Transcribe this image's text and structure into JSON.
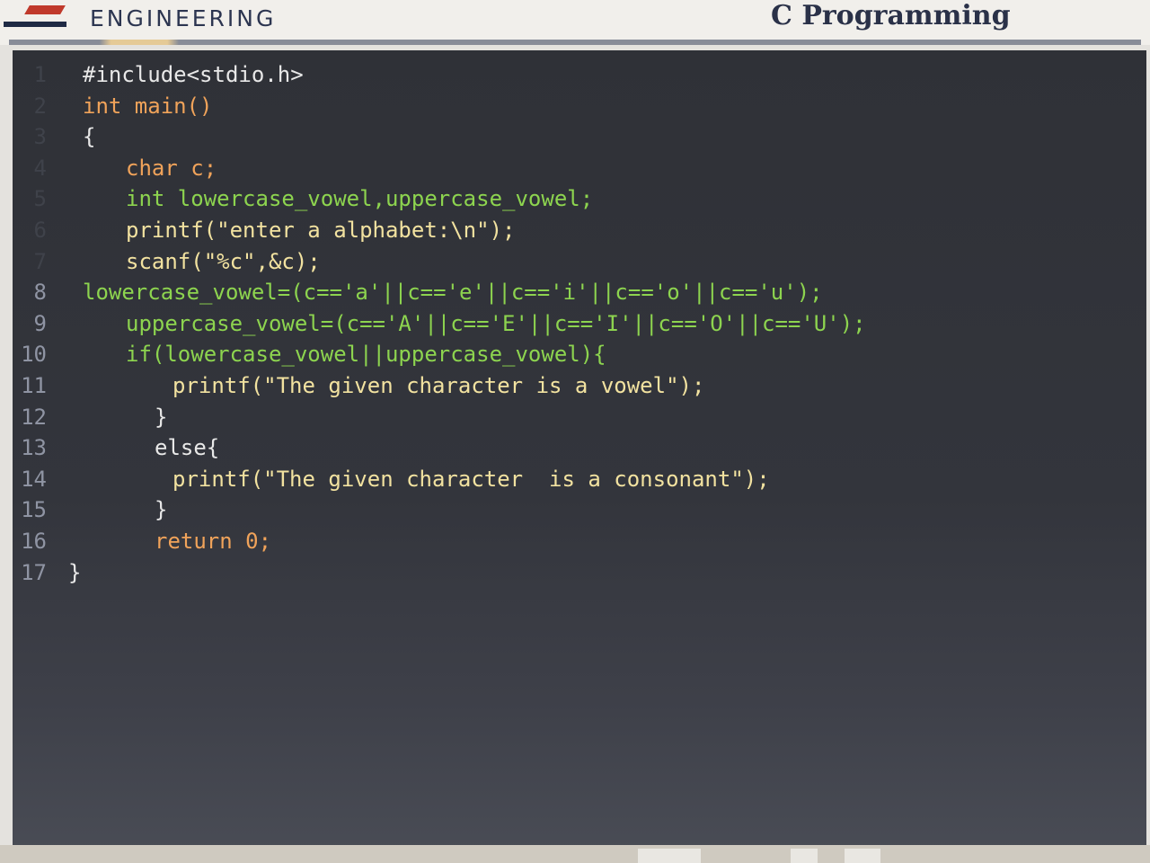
{
  "header": {
    "brand": "ENGINEERING",
    "course_title": "C Programming"
  },
  "editor": {
    "lines": [
      {
        "num": "1",
        "text": "#include<stdio.h>"
      },
      {
        "num": "2",
        "text": "int main()"
      },
      {
        "num": "3",
        "text": "{"
      },
      {
        "num": "4",
        "text": "char c;"
      },
      {
        "num": "5",
        "text": "int lowercase_vowel,uppercase_vowel;"
      },
      {
        "num": "6",
        "text": "printf(\"enter a alphabet:\\n\");"
      },
      {
        "num": "7",
        "text": "scanf(\"%c\",&c);"
      },
      {
        "num": "8",
        "text": "lowercase_vowel=(c=='a'||c=='e'||c=='i'||c=='o'||c=='u');"
      },
      {
        "num": "9",
        "text": "uppercase_vowel=(c=='A'||c=='E'||c=='I'||c=='O'||c=='U');"
      },
      {
        "num": "10",
        "text": "if(lowercase_vowel||uppercase_vowel){"
      },
      {
        "num": "11",
        "text": "printf(\"The given character is a vowel\");"
      },
      {
        "num": "12",
        "text": "}"
      },
      {
        "num": "13",
        "text": "else{"
      },
      {
        "num": "14",
        "text": "printf(\"The given character  is a consonant\");"
      },
      {
        "num": "15",
        "text": "}"
      },
      {
        "num": "16",
        "text": "return 0;"
      },
      {
        "num": "17",
        "text": "}"
      }
    ]
  },
  "colors": {
    "editor_bg": "#33353c",
    "keyword": "#f0a35a",
    "identifier": "#8dd44f",
    "string": "#f2e2a0",
    "line_number": "#8f94a3"
  }
}
